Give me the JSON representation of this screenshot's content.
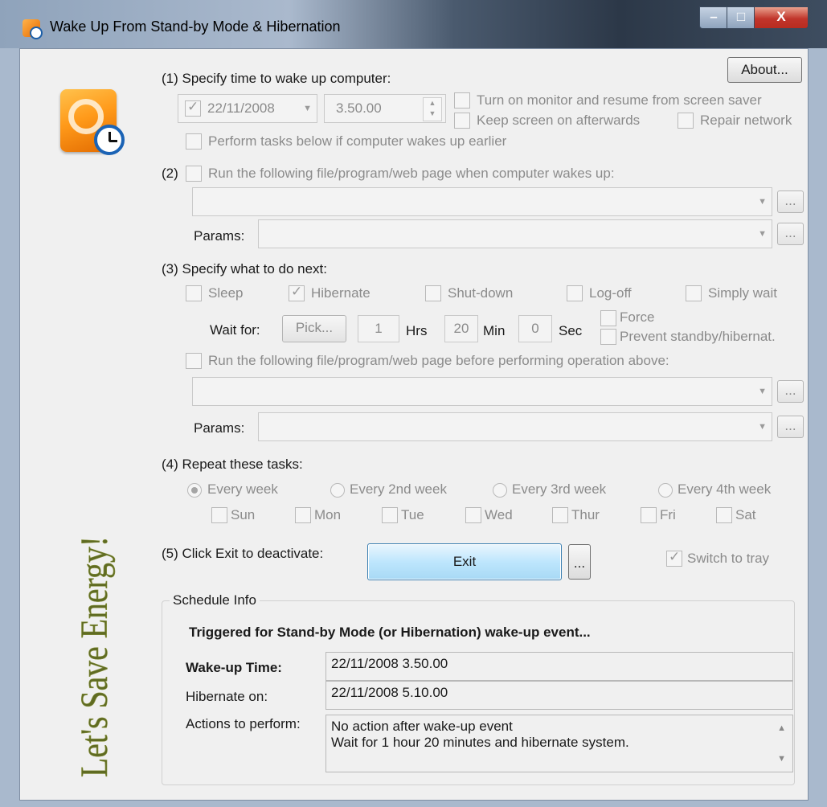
{
  "window": {
    "title": "Wake Up From Stand-by Mode & Hibernation",
    "close_glyph": "X"
  },
  "about_label": "About...",
  "slogan": "Let's Save Energy!",
  "section1": {
    "heading": "(1) Specify time to wake up computer:",
    "date_value": "22/11/2008",
    "time_value": "3.50.00",
    "turn_on_monitor": "Turn on monitor and resume from screen saver",
    "keep_screen_on": "Keep screen on afterwards",
    "repair_network": "Repair network",
    "perform_tasks_earlier": "Perform tasks below if computer wakes up earlier"
  },
  "section2": {
    "number": "(2)",
    "run_label": "Run the following file/program/web page when computer wakes up:",
    "params_label": "Params:",
    "browse_label": "..."
  },
  "section3": {
    "heading": "(3) Specify what to do next:",
    "options": {
      "sleep": "Sleep",
      "hibernate": "Hibernate",
      "shutdown": "Shut-down",
      "logoff": "Log-off",
      "simply_wait": "Simply wait"
    },
    "wait_for_label": "Wait for:",
    "pick_label": "Pick...",
    "hrs_value": "1",
    "hrs_label": "Hrs",
    "min_value": "20",
    "min_label": "Min",
    "sec_value": "0",
    "sec_label": "Sec",
    "force_label": "Force",
    "prevent_label": "Prevent standby/hibernat.",
    "run_before_label": "Run the following file/program/web page before performing operation above:",
    "params_label": "Params:",
    "browse_label": "..."
  },
  "section4": {
    "heading": "(4) Repeat these tasks:",
    "repeat_options": [
      "Every week",
      "Every 2nd week",
      "Every 3rd week",
      "Every 4th week"
    ],
    "days": [
      "Sun",
      "Mon",
      "Tue",
      "Wed",
      "Thur",
      "Fri",
      "Sat"
    ]
  },
  "section5": {
    "heading": "(5) Click Exit to deactivate:",
    "exit_label": "Exit",
    "more_label": "...",
    "switch_to_tray": "Switch to tray"
  },
  "schedule": {
    "legend": "Schedule Info",
    "triggered": "Triggered for Stand-by Mode (or Hibernation) wake-up event...",
    "wakeup_label": "Wake-up Time:",
    "wakeup_value": "22/11/2008 3.50.00",
    "hibernate_label": "Hibernate on:",
    "hibernate_value": "22/11/2008 5.10.00",
    "actions_label": "Actions to perform:",
    "actions_line1": "No action after wake-up event",
    "actions_line2": "Wait for 1 hour 20 minutes and hibernate system."
  },
  "colors": {
    "window_bg": "#f0f0f0",
    "disabled_text": "#8b8b8b",
    "exit_button": "#bee6fd",
    "slogan": "#5f6b22",
    "close_button": "#c1352b"
  }
}
